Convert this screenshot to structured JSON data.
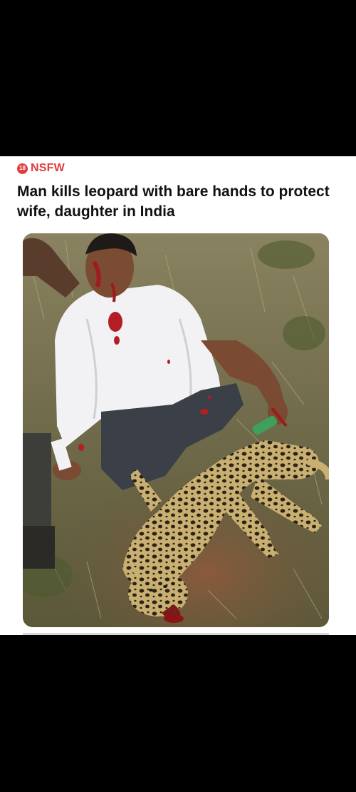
{
  "post": {
    "badge_number": "18",
    "label": "NSFW",
    "label_color": "#e23b3b",
    "headline": "Man kills leopard with bare hands to protect wife, daughter in India"
  },
  "image": {
    "subject": "photo"
  }
}
